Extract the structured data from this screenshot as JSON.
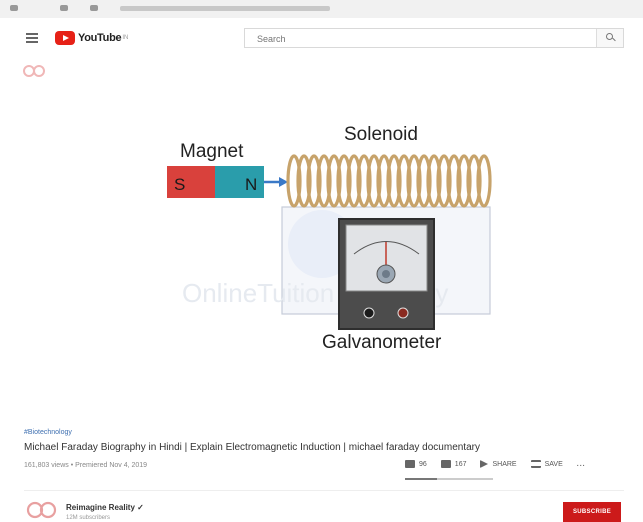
{
  "app": {
    "logo_text": "YouTube",
    "logo_sup": "IN"
  },
  "search": {
    "placeholder": "Search"
  },
  "video": {
    "diagram": {
      "magnet_label": "Magnet",
      "pole_s": "S",
      "pole_n": "N",
      "solenoid_label": "Solenoid",
      "galvanometer_label": "Galvanometer",
      "watermark": "OnlineTuition Academy"
    },
    "hashtag": "#Biotechnology",
    "title": "Michael Faraday Biography in Hindi | Explain Electromagnetic Induction | michael faraday documentary",
    "meta": "161,803 views • Premiered Nov 4, 2019",
    "likes": "96",
    "dislikes": "167",
    "share_label": "SHARE",
    "save_label": "SAVE",
    "more_label": "...",
    "like_ratio": 0.36
  },
  "channel": {
    "name": "Reimagine Reality",
    "verified_mark": "✓",
    "subscribers": "12M subscribers"
  },
  "subscribe_label": "SUBSCRIBE",
  "colors": {
    "brand_red": "#e62117",
    "subscribe_red": "#cc1a1a",
    "link_blue": "#3e6fb0",
    "magnet_s": "#d9413c",
    "magnet_n": "#2a9dab",
    "coil": "#c7a36b"
  },
  "icons": [
    "hamburger-icon",
    "youtube-logo-icon",
    "search-icon",
    "like-icon",
    "dislike-icon",
    "share-icon",
    "save-icon",
    "more-icon",
    "channel-avatar-icon"
  ]
}
